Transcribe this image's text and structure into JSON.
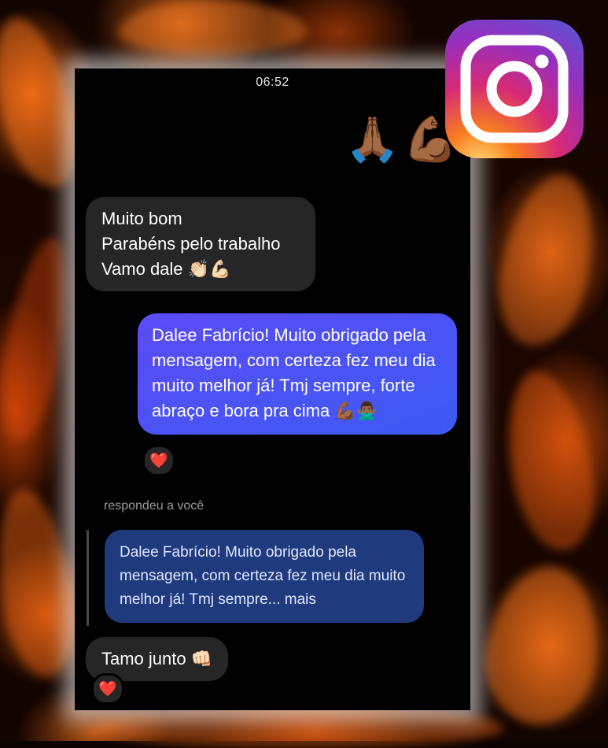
{
  "status_bar": {
    "time": "06:52"
  },
  "messages": {
    "top_emoji": [
      "🙏🏾",
      "💪🏾"
    ],
    "first": {
      "lines": [
        "Muito bom",
        "Parabéns pelo trabalho",
        "Vamo dale 👏🏻💪🏻"
      ]
    },
    "sent": {
      "text": "Dalee Fabrício! Muito obrigado pela mensagem, com certeza fez meu dia muito melhor já! Tmj sempre, forte abraço e bora pra cima 💪🏾🙅🏾‍♂️",
      "reaction": "❤️"
    },
    "reply": {
      "label": "respondeu a você",
      "quoted_text": "Dalee Fabrício! Muito obrigado pela mensagem, com certeza fez meu dia muito melhor já! Tmj sempre... mais",
      "text": "Tamo junto 👊🏻",
      "reaction": "❤️"
    }
  },
  "brand": {
    "icon": "instagram-logo",
    "colors": [
      "#feda75",
      "#fa7e1e",
      "#d62976",
      "#962fbf",
      "#4f5bd5"
    ]
  }
}
